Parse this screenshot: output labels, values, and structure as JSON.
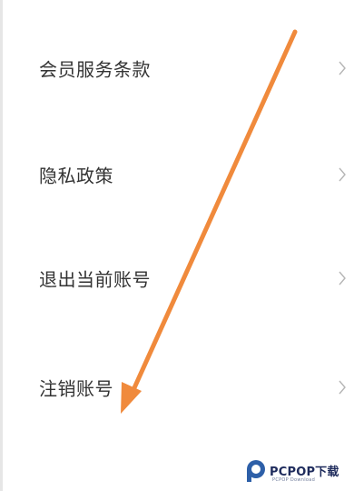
{
  "menu": {
    "items": [
      {
        "label": "会员服务条款",
        "chevron": "chevron-right-icon"
      },
      {
        "label": "隐私政策",
        "chevron": "chevron-right-icon"
      },
      {
        "label": "退出当前账号",
        "chevron": "chevron-right-icon"
      },
      {
        "label": "注销账号",
        "chevron": "chevron-right-icon"
      }
    ]
  },
  "annotation": {
    "arrow_color": "#f08a3c",
    "arrow_icon": "arrow-down-left-icon"
  },
  "watermark": {
    "text": "PCPOP下载",
    "subtext": "PCPOP Download",
    "colors": {
      "primary": "#1e2b5c",
      "logo": "#2d5fa8"
    }
  }
}
